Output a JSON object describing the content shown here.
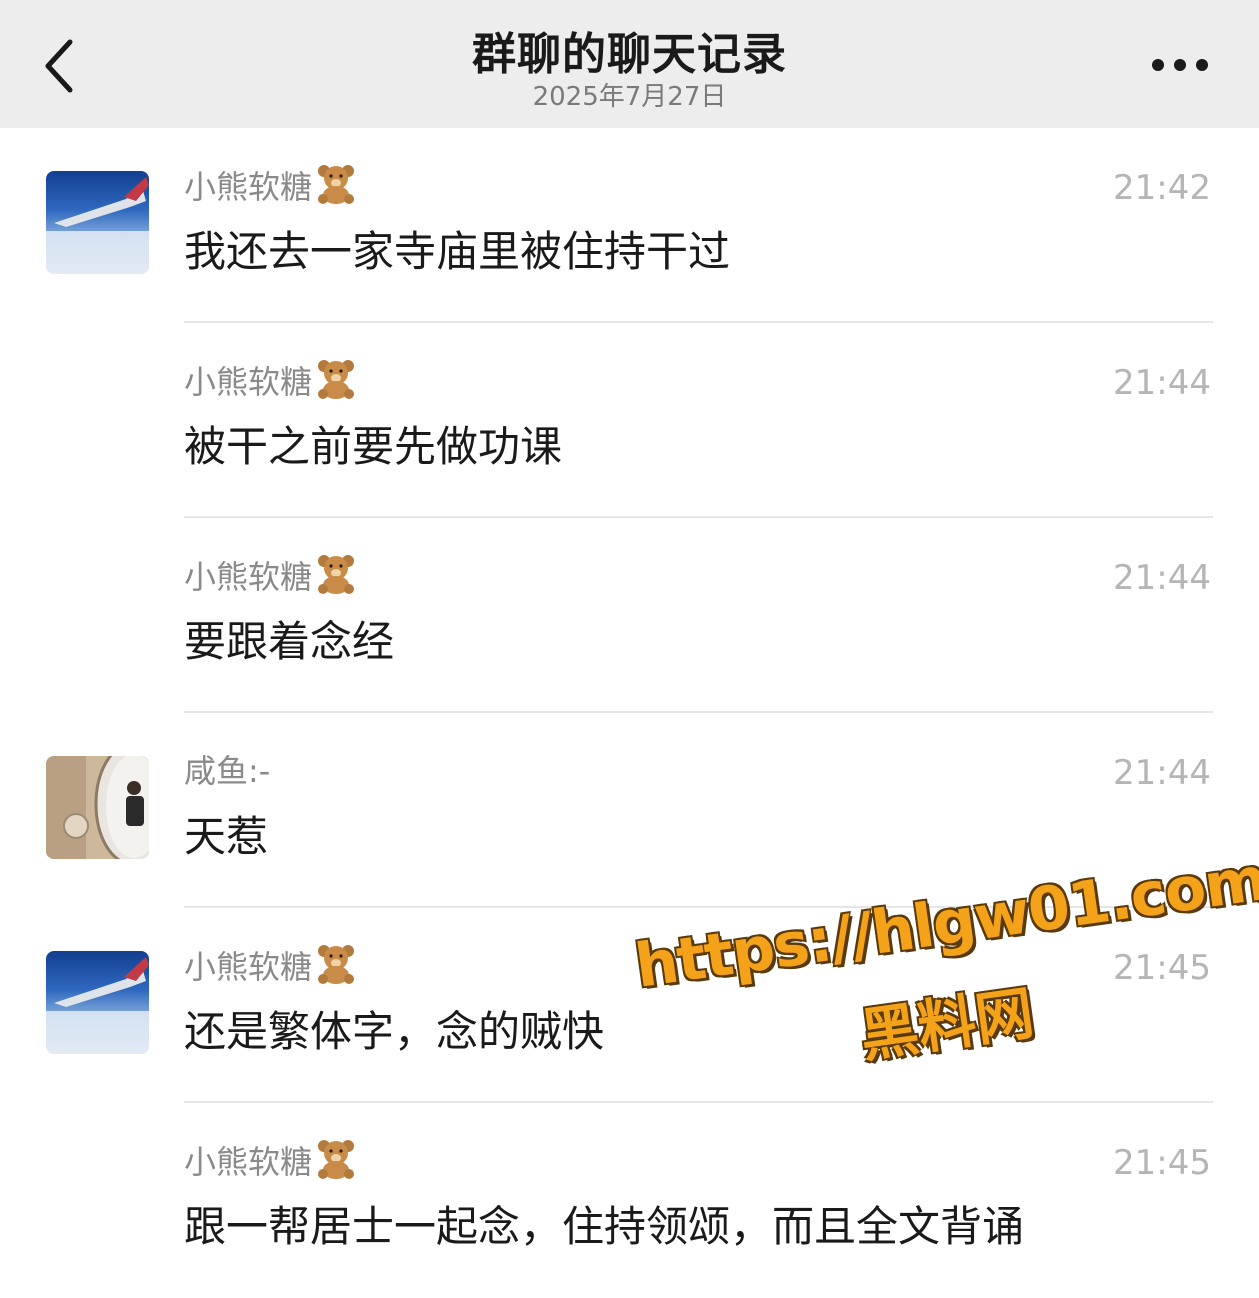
{
  "header": {
    "title": "群聊的聊天记录",
    "subtitle": "2025年7月27日",
    "back_icon": "chevron-left-icon",
    "more_icon": "more-dots-icon"
  },
  "messages": [
    {
      "sender": "小熊软糖",
      "emoji": "teddy-bear-icon",
      "avatar": "airplane-wing-sky",
      "time": "21:42",
      "text": "我还去一家寺庙里被住持干过"
    },
    {
      "sender": "小熊软糖",
      "emoji": "teddy-bear-icon",
      "avatar": "",
      "time": "21:44",
      "text": "被干之前要先做功课"
    },
    {
      "sender": "小熊软糖",
      "emoji": "teddy-bear-icon",
      "avatar": "",
      "time": "21:44",
      "text": "要跟着念经"
    },
    {
      "sender": "咸鱼:-",
      "emoji": "",
      "avatar": "mirror-selfie",
      "time": "21:44",
      "text": "天惹"
    },
    {
      "sender": "小熊软糖",
      "emoji": "teddy-bear-icon",
      "avatar": "airplane-wing-sky",
      "time": "21:45",
      "text": "还是繁体字，念的贼快"
    },
    {
      "sender": "小熊软糖",
      "emoji": "teddy-bear-icon",
      "avatar": "",
      "time": "21:45",
      "text": "跟一帮居士一起念，住持领颂，而且全文背诵"
    }
  ],
  "watermark": {
    "url": "https://hlgw01.com",
    "name": "黑料网",
    "color": "#f5a21b"
  }
}
